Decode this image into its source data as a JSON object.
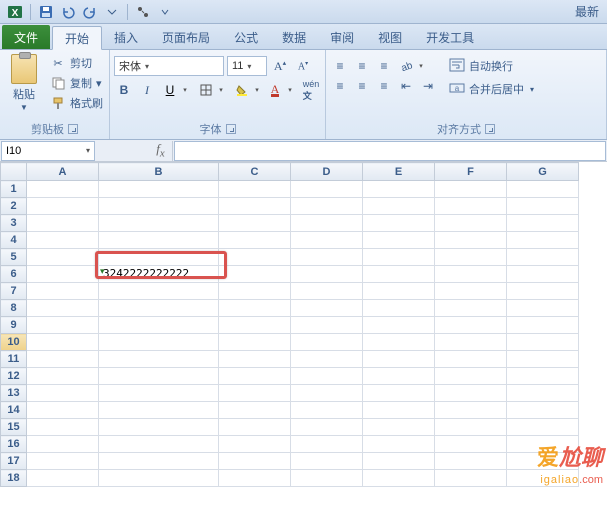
{
  "titlebar": {
    "right_text": "最新"
  },
  "tabs": {
    "file": "文件",
    "home": "开始",
    "insert": "插入",
    "page_layout": "页面布局",
    "formulas": "公式",
    "data": "数据",
    "review": "审阅",
    "view": "视图",
    "developer": "开发工具"
  },
  "clipboard": {
    "paste": "粘贴",
    "cut": "剪切",
    "copy": "复制",
    "format_painter": "格式刷",
    "group_label": "剪贴板"
  },
  "font": {
    "name": "宋体",
    "size": "11",
    "group_label": "字体"
  },
  "alignment": {
    "wrap": "自动换行",
    "merge": "合并后居中",
    "group_label": "对齐方式"
  },
  "namebox": {
    "value": "I10"
  },
  "grid": {
    "cols": [
      "A",
      "B",
      "C",
      "D",
      "E",
      "F",
      "G"
    ],
    "rows": [
      "1",
      "2",
      "3",
      "4",
      "5",
      "6",
      "7",
      "8",
      "9",
      "10",
      "11",
      "12",
      "13",
      "14",
      "15",
      "16",
      "17",
      "18"
    ],
    "b6": "3242222222222"
  },
  "watermark": {
    "t1": "爱",
    "t2": "尬聊",
    "u1": "igaliao",
    "u2": ".com"
  }
}
